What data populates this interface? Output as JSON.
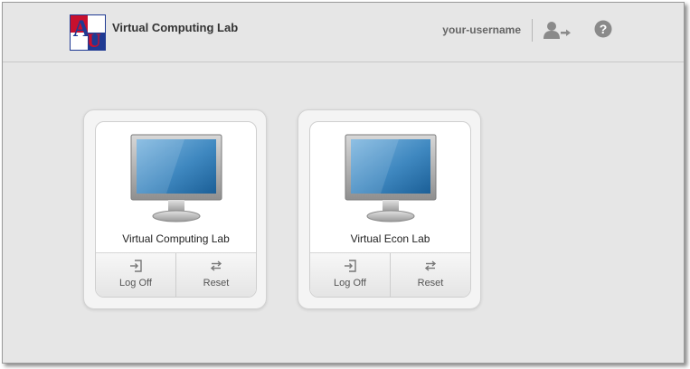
{
  "header": {
    "app_title": "Virtual Computing Lab",
    "username": "your-username",
    "logo_icon": "american-university-logo",
    "switch_user_icon": "user-switch-icon",
    "help_icon": "help-icon"
  },
  "tiles": [
    {
      "name": "Virtual Computing Lab",
      "icon": "monitor-icon",
      "actions": [
        {
          "label": "Log Off",
          "icon": "log-off-icon"
        },
        {
          "label": "Reset",
          "icon": "reset-icon"
        }
      ]
    },
    {
      "name": "Virtual Econ Lab",
      "icon": "monitor-icon",
      "actions": [
        {
          "label": "Log Off",
          "icon": "log-off-icon"
        },
        {
          "label": "Reset",
          "icon": "reset-icon"
        }
      ]
    }
  ],
  "colors": {
    "background": "#e6e6e6",
    "logo_red": "#c8102e",
    "logo_blue": "#1f3a93",
    "screen_blue": "#3f88c0",
    "text": "#333333",
    "muted_text": "#666666"
  }
}
